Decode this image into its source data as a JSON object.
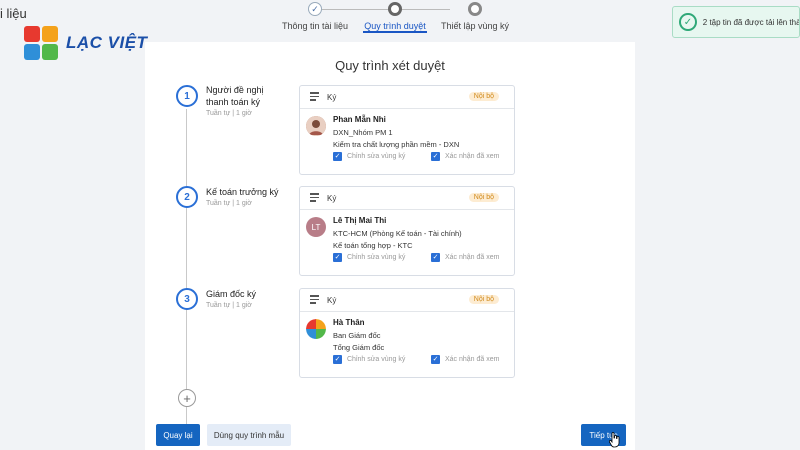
{
  "page": {
    "title_fragment": "i liệu"
  },
  "brand": {
    "name": "LẠC VIỆT"
  },
  "stepper": {
    "steps": [
      {
        "label": "Thông tin tài liệu",
        "state": "done"
      },
      {
        "label": "Quy trình duyệt",
        "state": "current"
      },
      {
        "label": "Thiết lập vùng ký",
        "state": "todo"
      }
    ]
  },
  "toast": {
    "message": "2 tập tin đã được tải lên thà"
  },
  "workflow": {
    "title": "Quy trình xét duyệt",
    "steps": [
      {
        "number": "1",
        "name": "Người đề nghị thanh toán ký",
        "sub": "Tuần tự | 1 giờ",
        "card": {
          "type": "Ký",
          "badge": "Nội bộ",
          "person": "Phan Mẫn Nhi",
          "line1": "DXN_Nhóm PM 1",
          "line2": "Kiểm tra chất lượng phần mềm - DXN",
          "check1": "Chỉnh sửa vùng ký",
          "check2": "Xác nhận đã xem"
        }
      },
      {
        "number": "2",
        "name": "Kế toán trưởng ký",
        "sub": "Tuần tự | 1 giờ",
        "card": {
          "type": "Ký",
          "badge": "Nội bộ",
          "avatar_initials": "LT",
          "person": "Lê Thị Mai Thi",
          "line1": "KTC-HCM (Phòng Kế toán - Tài chính)",
          "line2": "Kế toán tổng hợp - KTC",
          "check1": "Chỉnh sửa vùng ký",
          "check2": "Xác nhận đã xem"
        }
      },
      {
        "number": "3",
        "name": "Giám đốc ký",
        "sub": "Tuần tự | 1 giờ",
        "card": {
          "type": "Ký",
          "badge": "Nội bộ",
          "person": "Hà Thân",
          "line1": "Ban Giám đốc",
          "line2": "Tổng Giám đốc",
          "check1": "Chỉnh sửa vùng ký",
          "check2": "Xác nhận đã xem"
        }
      }
    ],
    "add_icon": "plus-icon"
  },
  "footer": {
    "back_label": "Quay lại",
    "template_label": "Dùng quy trình mẫu",
    "next_label": "Tiếp tục"
  },
  "colors": {
    "primary": "#1565c0",
    "accent_blue": "#2a6fd6",
    "badge_bg": "#fdecd2",
    "badge_text": "#d08a1c",
    "toast_bg": "#e7f7f0",
    "toast_icon": "#2fa878"
  }
}
